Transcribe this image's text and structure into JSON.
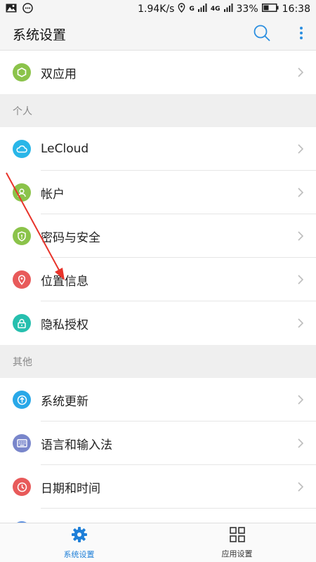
{
  "status_bar": {
    "speed": "1.94K/s",
    "net_g": "G",
    "net_4g": "4G",
    "battery": "33%",
    "time": "16:38"
  },
  "app_bar": {
    "title": "系统设置",
    "search_icon": "search-icon",
    "menu_icon": "more-vert-icon"
  },
  "rows_top": [
    {
      "label": "双应用",
      "icon": "hexagon-icon",
      "color": "#8bc34a"
    }
  ],
  "section_personal": {
    "header": "个人",
    "items": [
      {
        "label": "LeCloud",
        "icon": "cloud-icon",
        "color": "#29b6e8"
      },
      {
        "label": "帐户",
        "icon": "person-icon",
        "color": "#8bc34a"
      },
      {
        "label": "密码与安全",
        "icon": "shield-icon",
        "color": "#8bc34a"
      },
      {
        "label": "位置信息",
        "icon": "location-pin-icon",
        "color": "#e85a5a"
      },
      {
        "label": "隐私授权",
        "icon": "lock-icon",
        "color": "#26bfae"
      }
    ]
  },
  "section_other": {
    "header": "其他",
    "items": [
      {
        "label": "系统更新",
        "icon": "update-arrow-icon",
        "color": "#29a8e8"
      },
      {
        "label": "语言和输入法",
        "icon": "keyboard-icon",
        "color": "#7986cb"
      },
      {
        "label": "日期和时间",
        "icon": "clock-icon",
        "color": "#e85a5a"
      }
    ]
  },
  "bottom_nav": {
    "items": [
      {
        "label": "系统设置",
        "icon": "gear-icon",
        "active": true
      },
      {
        "label": "应用设置",
        "icon": "grid-icon",
        "active": false
      }
    ]
  },
  "colors": {
    "accent": "#1e7fd8",
    "annotation_arrow": "#e8332a"
  }
}
